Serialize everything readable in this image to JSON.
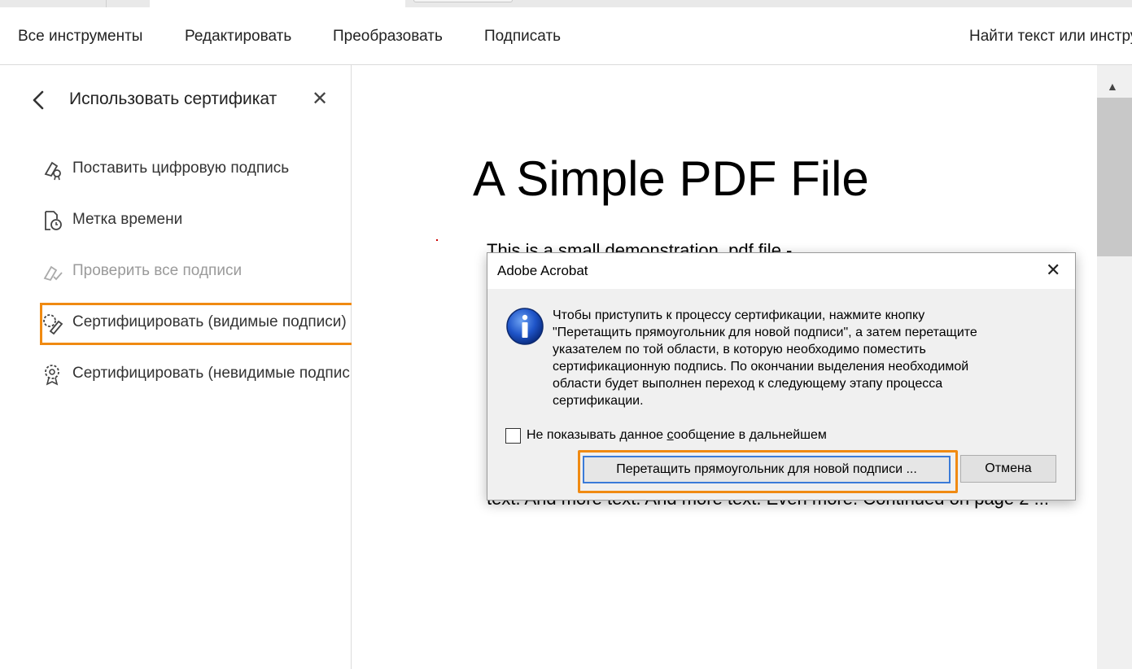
{
  "menu": {
    "items": [
      "Все инструменты",
      "Редактировать",
      "Преобразовать",
      "Подписать"
    ],
    "search_placeholder": "Найти текст или инструмент"
  },
  "panel": {
    "title": "Использовать сертификат",
    "items": [
      {
        "label": "Поставить цифровую подпись",
        "icon": "digital-signature-icon",
        "disabled": false
      },
      {
        "label": "Метка времени",
        "icon": "timestamp-icon",
        "disabled": false
      },
      {
        "label": "Проверить все подписи",
        "icon": "validate-signatures-icon",
        "disabled": true
      },
      {
        "label": "Сертифицировать (видимые подписи)",
        "icon": "certify-visible-icon",
        "disabled": false
      },
      {
        "label": "Сертифицировать (невидимые подписи)",
        "icon": "certify-invisible-icon",
        "disabled": false
      }
    ]
  },
  "document": {
    "title": "A Simple PDF File",
    "line1": "This is a small demonstration .pdf file -",
    "line2": "text. And more text. And more text. Even more. Continued on page 2 ..."
  },
  "dialog": {
    "title": "Adobe Acrobat",
    "message": "Чтобы приступить к процессу сертификации, нажмите кнопку\n\"Перетащить прямоугольник для новой подписи\", а затем перетащите\nуказателем по той области, в которую необходимо поместить\nсертификационную подпись. По окончании выделения необходимой\nобласти будет выполнен переход к следующему этапу процесса\nсертификации.",
    "checkbox_label_pre": "Не показывать данное ",
    "checkbox_label_underlined": "с",
    "checkbox_label_post": "ообщение в дальнейшем",
    "primary_button": "Перетащить прямоугольник для новой подписи ...",
    "cancel_button": "Отмена"
  },
  "colors": {
    "accent": "#1473e6",
    "highlight": "#f08a12"
  }
}
